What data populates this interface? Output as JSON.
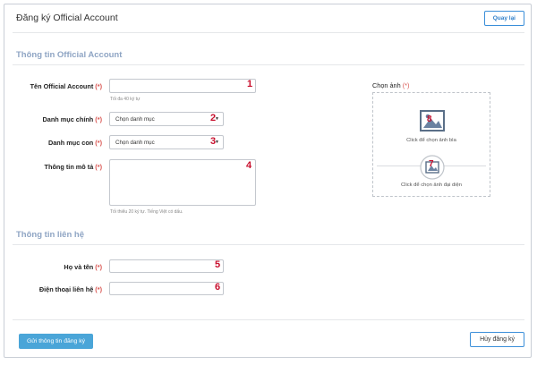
{
  "header": {
    "title": "Đăng ký Official Account",
    "back_label": "Quay lại"
  },
  "sections": {
    "oa_info": "Thông tin Official Account",
    "contact": "Thông tin liên hệ"
  },
  "form": {
    "oa_name": {
      "label": "Tên Official Account",
      "req": "(*)",
      "value": "",
      "hint": "Tối đa 40 ký tự",
      "marker": "1"
    },
    "category": {
      "label": "Danh mục chính",
      "req": "(*)",
      "value": "Chọn danh mục",
      "marker": "2"
    },
    "subcategory": {
      "label": "Danh mục con",
      "req": "(*)",
      "value": "Chọn danh mục",
      "marker": "3"
    },
    "description": {
      "label": "Thông tin mô tả",
      "req": "(*)",
      "value": "",
      "hint": "Tối thiểu 20 ký tự. Tiếng Việt có dấu.",
      "marker": "4"
    },
    "fullname": {
      "label": "Họ và tên",
      "req": "(*)",
      "value": "",
      "marker": "5"
    },
    "phone": {
      "label": "Điện thoại liên hệ",
      "req": "(*)",
      "value": "",
      "marker": "6"
    }
  },
  "image_picker": {
    "label": "Chọn ảnh",
    "req": "(*)",
    "cover_text": "Click để chọn ảnh bìa",
    "cover_marker": "8",
    "avatar_text": "Click để chọn ảnh đại diện",
    "avatar_marker": "7"
  },
  "footer": {
    "submit_label": "Gửi thông tin đăng ký",
    "cancel_label": "Hủy đăng ký"
  },
  "colors": {
    "accent": "#4aa5d8",
    "section_title": "#8fa5c4",
    "required": "#d9534f",
    "marker": "#c8102e"
  }
}
